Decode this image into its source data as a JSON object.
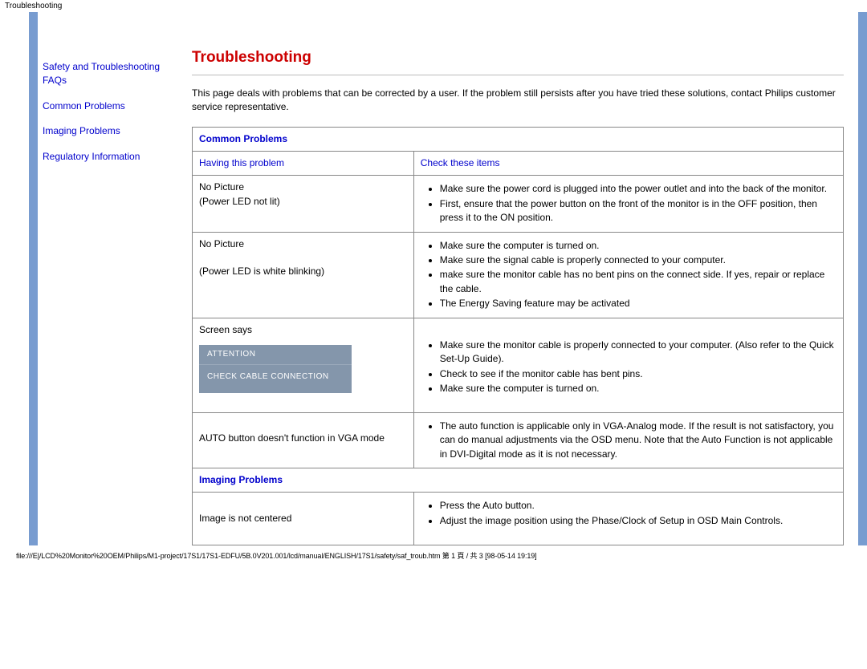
{
  "header": {
    "text": "Troubleshooting"
  },
  "sidebar": {
    "items": [
      {
        "label": "Safety and Troubleshooting"
      },
      {
        "label": "FAQs"
      },
      {
        "label": "Common Problems"
      },
      {
        "label": "Imaging Problems"
      },
      {
        "label": "Regulatory Information"
      }
    ]
  },
  "main": {
    "title": "Troubleshooting",
    "intro": "This page deals with problems that can be corrected by a user. If the problem still persists after you have tried these solutions, contact Philips customer service representative.",
    "section1_title": "Common Problems",
    "col_problem": "Having this problem",
    "col_check": "Check these items",
    "rows": [
      {
        "problem_line1": "No Picture",
        "problem_line2": "(Power LED not lit)",
        "checks": [
          "Make sure the power cord is plugged into the power outlet and into the back of the monitor.",
          "First, ensure that the power button on the front of the monitor is in the OFF position, then press it to the ON position."
        ]
      },
      {
        "problem_line1": "No Picture",
        "problem_line2": "(Power LED is white blinking)",
        "checks": [
          "Make sure the computer is turned on.",
          "Make sure the signal cable is properly connected to your computer.",
          "make sure the monitor cable has no bent pins on the connect side. If yes, repair or replace the cable.",
          "The Energy Saving feature may be activated"
        ]
      },
      {
        "problem_line1": "Screen says",
        "attention_title": "ATTENTION",
        "attention_body": "CHECK CABLE CONNECTION",
        "checks": [
          "Make sure the monitor cable is properly connected to your computer. (Also refer to the Quick Set-Up Guide).",
          "Check to see if the monitor cable has bent pins.",
          "Make sure the computer is turned on."
        ]
      },
      {
        "problem_line1": "AUTO button doesn't function in VGA mode",
        "checks": [
          "The auto function is applicable only in VGA-Analog mode.  If the result is not satisfactory, you can do manual adjustments via the OSD menu.  Note that the Auto Function is not applicable in DVI-Digital mode as it is not necessary."
        ]
      }
    ],
    "section2_title": "Imaging Problems",
    "rows2": [
      {
        "problem_line1": "Image is not centered",
        "checks": [
          "Press the Auto button.",
          "Adjust the image position using the Phase/Clock of Setup in OSD Main Controls."
        ]
      }
    ]
  },
  "footer": {
    "path": "file:///E|/LCD%20Monitor%20OEM/Philips/M1-project/17S1/17S1-EDFU/5B.0V201.001/lcd/manual/ENGLISH/17S1/safety/saf_troub.htm 第 1 頁 / 共 3  [98-05-14 19:19]"
  }
}
